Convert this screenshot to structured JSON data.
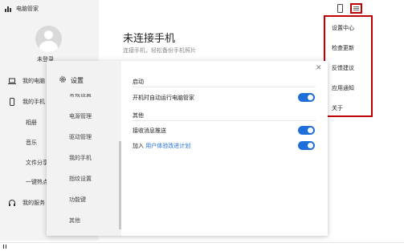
{
  "app": {
    "title": "电脑管家"
  },
  "user": {
    "login_label": "未登录"
  },
  "sidebar": {
    "items": [
      {
        "label": "我的电脑",
        "icon": "laptop-icon"
      },
      {
        "label": "我的手机",
        "icon": "phone-icon"
      },
      {
        "label": "相册"
      },
      {
        "label": "音乐"
      },
      {
        "label": "文件分享"
      },
      {
        "label": "一键热点"
      },
      {
        "label": "我的服务",
        "icon": "headset-icon"
      }
    ]
  },
  "main": {
    "title": "未连接手机",
    "subtitle": "连接手机，轻松备份手机照片"
  },
  "menu": {
    "items": [
      "设置中心",
      "检查更新",
      "反馈建议",
      "应用通知",
      "关于"
    ]
  },
  "settings_dialog": {
    "title": "设置",
    "nav": [
      "常规设置",
      "电源管理",
      "驱动管理",
      "我的手机",
      "指纹设置",
      "功能键",
      "其他"
    ],
    "sections": [
      {
        "title": "启动",
        "rows": [
          {
            "label": "开机时自动运行电脑管家",
            "enabled": true
          }
        ]
      },
      {
        "title": "其他",
        "rows": [
          {
            "label": "接收消息推送",
            "enabled": true
          },
          {
            "prefix": "加入",
            "link": "用户体验改进计划",
            "enabled": true
          }
        ]
      }
    ],
    "close_icon": "close-icon"
  },
  "colors": {
    "accent": "#1e6fd9",
    "highlight": "#c00000"
  }
}
